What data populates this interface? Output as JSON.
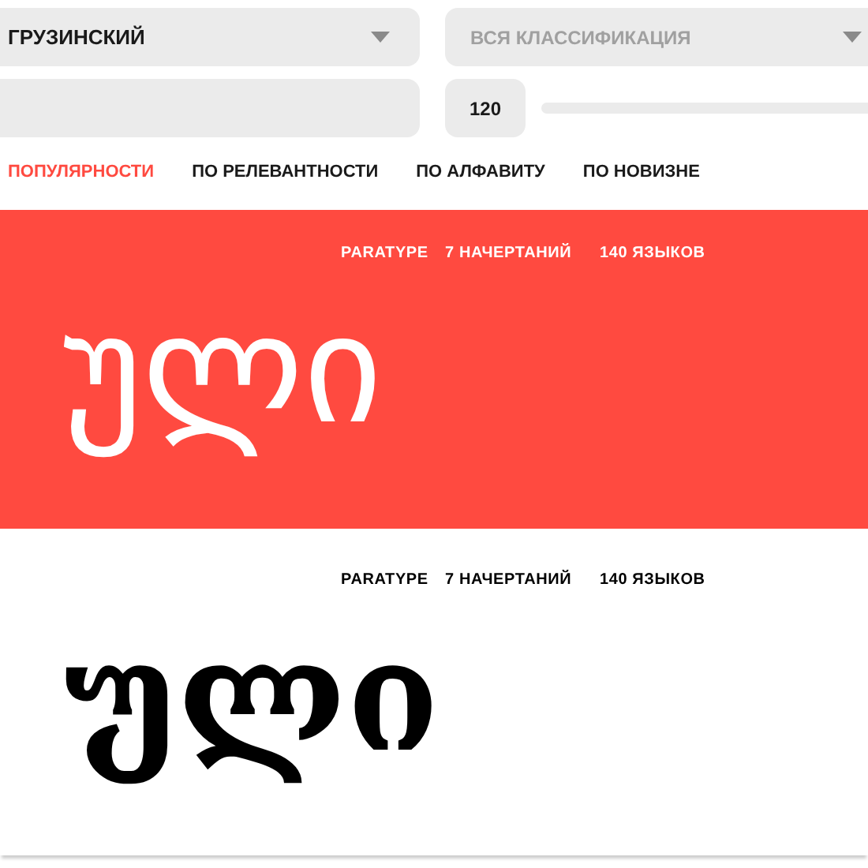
{
  "filters": {
    "language": {
      "value": "ГРУЗИНСКИЙ"
    },
    "classification": {
      "placeholder": "ВСЯ КЛАССИФИКАЦИЯ"
    },
    "size": {
      "value": "120"
    }
  },
  "sort_tabs": [
    {
      "label": "ПОПУЛЯРНОСТИ",
      "selected": true
    },
    {
      "label": "ПО РЕЛЕВАНТНОСТИ",
      "selected": false
    },
    {
      "label": "ПО АЛФАВИТУ",
      "selected": false
    },
    {
      "label": "ПО НОВИЗНЕ",
      "selected": false
    }
  ],
  "fonts": [
    {
      "kind": "accent",
      "foundry": "PARATYPE",
      "styles": "7 НАЧЕРТАНИЙ",
      "languages": "140 ЯЗЫКОВ",
      "sample": "ული"
    },
    {
      "kind": "plain",
      "foundry": "PARATYPE",
      "styles": "7 НАЧЕРТАНИЙ",
      "languages": "140 ЯЗЫКОВ",
      "sample": "ული"
    }
  ]
}
